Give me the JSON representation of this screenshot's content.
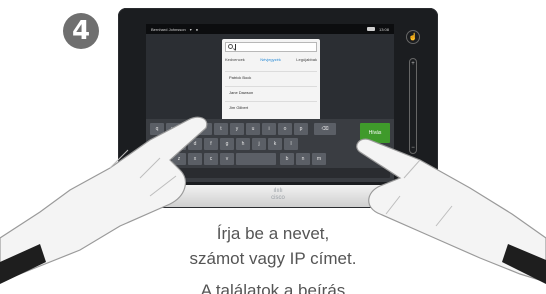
{
  "step": {
    "number": "4"
  },
  "statusbar": {
    "user": "Bernhard Johnsson",
    "time": "13:08",
    "camera_icon": "camera-icon"
  },
  "search": {
    "value": "",
    "placeholder": ""
  },
  "tabs": [
    {
      "label": "Kedvencek",
      "active": false
    },
    {
      "label": "Névjegyzék",
      "active": true
    },
    {
      "label": "Legújabbak",
      "active": false
    }
  ],
  "contacts": [
    {
      "name": "Patrick Bock"
    },
    {
      "name": "Jane Dawson"
    },
    {
      "name": "Jim Gilbert"
    }
  ],
  "keyboard": {
    "row1": [
      "q",
      "w",
      "e",
      "r",
      "t",
      "y",
      "u",
      "i",
      "o",
      "p"
    ],
    "row2": [
      "a",
      "s",
      "d",
      "f",
      "g",
      "h",
      "j",
      "k",
      "l"
    ],
    "row3": [
      "z",
      "x",
      "c",
      "v",
      "b",
      "n",
      "m"
    ],
    "go_label": "Hívás",
    "backspace_icon": "backspace-icon"
  },
  "side": {
    "volume_plus": "+",
    "volume_minus": "−",
    "top_icon": "touch-icon",
    "bottom_icon": "info-icon"
  },
  "brand": {
    "name": "cisco"
  },
  "caption": {
    "line1": "Írja be a nevet,",
    "line2": "számot vagy IP címet.",
    "line3": "A találatok a beírás"
  },
  "colors": {
    "accent": "#2a8bd6",
    "go": "#3f9a2b"
  }
}
